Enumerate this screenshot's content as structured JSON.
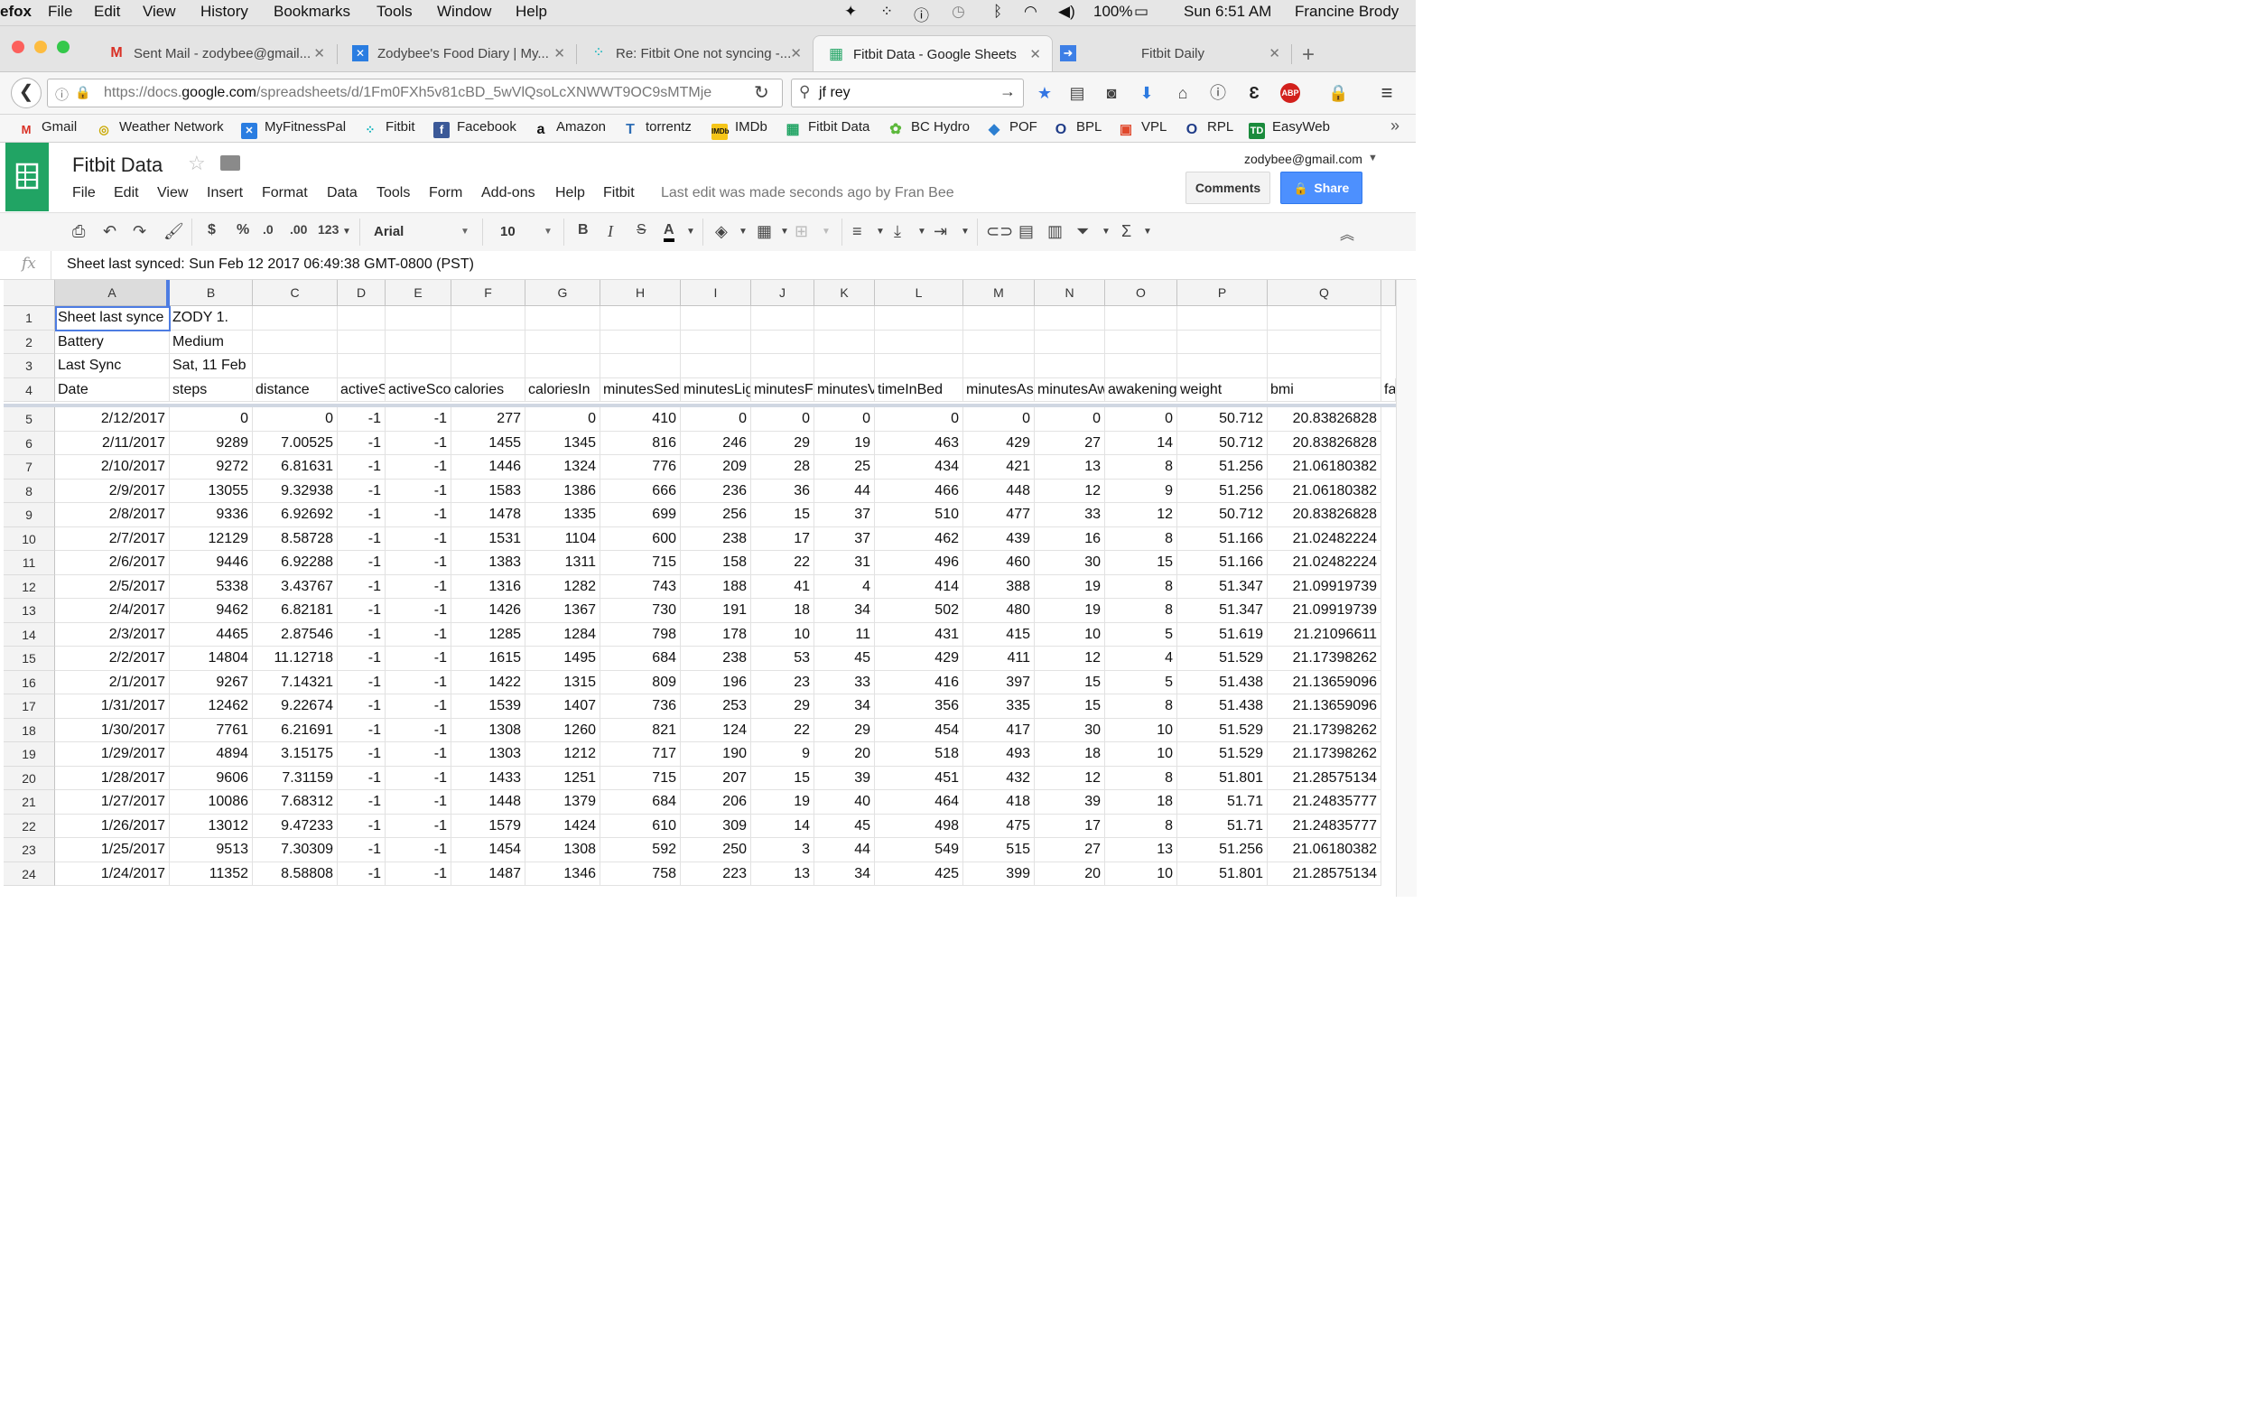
{
  "menubar": {
    "app": "efox",
    "items": [
      "File",
      "Edit",
      "View",
      "History",
      "Bookmarks",
      "Tools",
      "Window",
      "Help"
    ],
    "battery": "100%",
    "clock": "Sun 6:51 AM",
    "user": "Francine Brody"
  },
  "tabs": [
    {
      "title": "Sent Mail - zodybee@gmail...",
      "icon": "gmail-icon"
    },
    {
      "title": "Zodybee's Food Diary | My...",
      "icon": "myfitnesspal-icon"
    },
    {
      "title": "Re: Fitbit One not syncing -...",
      "icon": "fitbit-icon"
    },
    {
      "title": "Fitbit Data - Google Sheets",
      "icon": "sheets-icon"
    },
    {
      "title": "Fitbit Daily",
      "icon": "arrow-icon"
    }
  ],
  "navbar": {
    "url_host_prefix": "https://docs.",
    "url_host": "google.com",
    "url_path": "/spreadsheets/d/1Fm0FXh5v81cBD_5wVlQsoLcXNWWT9OC9sMTMje",
    "search_value": "jf rey"
  },
  "bookmarks": [
    {
      "label": "Gmail",
      "icon": "gmail-icon"
    },
    {
      "label": "Weather Network",
      "icon": "weather-icon"
    },
    {
      "label": "MyFitnessPal",
      "icon": "myfitnesspal-icon"
    },
    {
      "label": "Fitbit",
      "icon": "fitbit-icon"
    },
    {
      "label": "Facebook",
      "icon": "facebook-icon"
    },
    {
      "label": "Amazon",
      "icon": "amazon-icon"
    },
    {
      "label": "torrentz",
      "icon": "torrentz-icon"
    },
    {
      "label": "IMDb",
      "icon": "imdb-icon"
    },
    {
      "label": "Fitbit Data",
      "icon": "sheets-icon"
    },
    {
      "label": "BC Hydro",
      "icon": "bchydro-icon"
    },
    {
      "label": "POF",
      "icon": "pof-icon"
    },
    {
      "label": "BPL",
      "icon": "bpl-icon"
    },
    {
      "label": "VPL",
      "icon": "vpl-icon"
    },
    {
      "label": "RPL",
      "icon": "rpl-icon"
    },
    {
      "label": "EasyWeb",
      "icon": "td-icon"
    }
  ],
  "sheets": {
    "title": "Fitbit Data",
    "menus": [
      "File",
      "Edit",
      "View",
      "Insert",
      "Format",
      "Data",
      "Tools",
      "Form",
      "Add-ons",
      "Help",
      "Fitbit"
    ],
    "last_edit": "Last edit was made seconds ago by Fran Bee",
    "account": "zodybee@gmail.com",
    "comments_label": "Comments",
    "share_label": "Share"
  },
  "toolbar": {
    "currency": "$",
    "percent": "%",
    "dec_less": ".0",
    "dec_more": ".00",
    "format_more": "123",
    "font": "Arial",
    "size": "10",
    "bold": "B",
    "italic": "I",
    "strike": "S",
    "textcolor": "A"
  },
  "formula": {
    "fx": "fx",
    "value": "Sheet last synced: Sun Feb 12 2017 06:49:38 GMT-0800 (PST)"
  },
  "colors": {
    "sheets_green": "#21a464",
    "share_blue": "#4d90fe",
    "selection": "#4d7ce2"
  },
  "grid": {
    "columns": [
      "A",
      "B",
      "C",
      "D",
      "E",
      "F",
      "G",
      "H",
      "I",
      "J",
      "K",
      "L",
      "M",
      "N",
      "O",
      "P",
      "Q"
    ],
    "rows": [
      {
        "n": "1",
        "cells": [
          "Sheet last synce",
          "ZODY 1."
        ]
      },
      {
        "n": "2",
        "cells": [
          "Battery",
          "Medium"
        ]
      },
      {
        "n": "3",
        "cells": [
          "Last Sync",
          "Sat, 11 Feb"
        ]
      },
      {
        "n": "4",
        "cells": [
          "Date",
          "steps",
          "distance",
          "activeS",
          "activeSco",
          "calories",
          "caloriesIn",
          "minutesSed",
          "minutesLig",
          "minutesF",
          "minutesV",
          "timeInBed",
          "minutesAs",
          "minutesAw",
          "awakening",
          "weight",
          "bmi",
          "fa"
        ]
      },
      {
        "n": "5",
        "cells": [
          "2/12/2017",
          "0",
          "0",
          "-1",
          "-1",
          "277",
          "0",
          "410",
          "0",
          "0",
          "0",
          "0",
          "0",
          "0",
          "0",
          "50.712",
          "20.83826828"
        ]
      },
      {
        "n": "6",
        "cells": [
          "2/11/2017",
          "9289",
          "7.00525",
          "-1",
          "-1",
          "1455",
          "1345",
          "816",
          "246",
          "29",
          "19",
          "463",
          "429",
          "27",
          "14",
          "50.712",
          "20.83826828"
        ]
      },
      {
        "n": "7",
        "cells": [
          "2/10/2017",
          "9272",
          "6.81631",
          "-1",
          "-1",
          "1446",
          "1324",
          "776",
          "209",
          "28",
          "25",
          "434",
          "421",
          "13",
          "8",
          "51.256",
          "21.06180382"
        ]
      },
      {
        "n": "8",
        "cells": [
          "2/9/2017",
          "13055",
          "9.32938",
          "-1",
          "-1",
          "1583",
          "1386",
          "666",
          "236",
          "36",
          "44",
          "466",
          "448",
          "12",
          "9",
          "51.256",
          "21.06180382"
        ]
      },
      {
        "n": "9",
        "cells": [
          "2/8/2017",
          "9336",
          "6.92692",
          "-1",
          "-1",
          "1478",
          "1335",
          "699",
          "256",
          "15",
          "37",
          "510",
          "477",
          "33",
          "12",
          "50.712",
          "20.83826828"
        ]
      },
      {
        "n": "10",
        "cells": [
          "2/7/2017",
          "12129",
          "8.58728",
          "-1",
          "-1",
          "1531",
          "1104",
          "600",
          "238",
          "17",
          "37",
          "462",
          "439",
          "16",
          "8",
          "51.166",
          "21.02482224"
        ]
      },
      {
        "n": "11",
        "cells": [
          "2/6/2017",
          "9446",
          "6.92288",
          "-1",
          "-1",
          "1383",
          "1311",
          "715",
          "158",
          "22",
          "31",
          "496",
          "460",
          "30",
          "15",
          "51.166",
          "21.02482224"
        ]
      },
      {
        "n": "12",
        "cells": [
          "2/5/2017",
          "5338",
          "3.43767",
          "-1",
          "-1",
          "1316",
          "1282",
          "743",
          "188",
          "41",
          "4",
          "414",
          "388",
          "19",
          "8",
          "51.347",
          "21.09919739"
        ]
      },
      {
        "n": "13",
        "cells": [
          "2/4/2017",
          "9462",
          "6.82181",
          "-1",
          "-1",
          "1426",
          "1367",
          "730",
          "191",
          "18",
          "34",
          "502",
          "480",
          "19",
          "8",
          "51.347",
          "21.09919739"
        ]
      },
      {
        "n": "14",
        "cells": [
          "2/3/2017",
          "4465",
          "2.87546",
          "-1",
          "-1",
          "1285",
          "1284",
          "798",
          "178",
          "10",
          "11",
          "431",
          "415",
          "10",
          "5",
          "51.619",
          "21.21096611"
        ]
      },
      {
        "n": "15",
        "cells": [
          "2/2/2017",
          "14804",
          "11.12718",
          "-1",
          "-1",
          "1615",
          "1495",
          "684",
          "238",
          "53",
          "45",
          "429",
          "411",
          "12",
          "4",
          "51.529",
          "21.17398262"
        ]
      },
      {
        "n": "16",
        "cells": [
          "2/1/2017",
          "9267",
          "7.14321",
          "-1",
          "-1",
          "1422",
          "1315",
          "809",
          "196",
          "23",
          "33",
          "416",
          "397",
          "15",
          "5",
          "51.438",
          "21.13659096"
        ]
      },
      {
        "n": "17",
        "cells": [
          "1/31/2017",
          "12462",
          "9.22674",
          "-1",
          "-1",
          "1539",
          "1407",
          "736",
          "253",
          "29",
          "34",
          "356",
          "335",
          "15",
          "8",
          "51.438",
          "21.13659096"
        ]
      },
      {
        "n": "18",
        "cells": [
          "1/30/2017",
          "7761",
          "6.21691",
          "-1",
          "-1",
          "1308",
          "1260",
          "821",
          "124",
          "22",
          "29",
          "454",
          "417",
          "30",
          "10",
          "51.529",
          "21.17398262"
        ]
      },
      {
        "n": "19",
        "cells": [
          "1/29/2017",
          "4894",
          "3.15175",
          "-1",
          "-1",
          "1303",
          "1212",
          "717",
          "190",
          "9",
          "20",
          "518",
          "493",
          "18",
          "10",
          "51.529",
          "21.17398262"
        ]
      },
      {
        "n": "20",
        "cells": [
          "1/28/2017",
          "9606",
          "7.31159",
          "-1",
          "-1",
          "1433",
          "1251",
          "715",
          "207",
          "15",
          "39",
          "451",
          "432",
          "12",
          "8",
          "51.801",
          "21.28575134"
        ]
      },
      {
        "n": "21",
        "cells": [
          "1/27/2017",
          "10086",
          "7.68312",
          "-1",
          "-1",
          "1448",
          "1379",
          "684",
          "206",
          "19",
          "40",
          "464",
          "418",
          "39",
          "18",
          "51.71",
          "21.24835777"
        ]
      },
      {
        "n": "22",
        "cells": [
          "1/26/2017",
          "13012",
          "9.47233",
          "-1",
          "-1",
          "1579",
          "1424",
          "610",
          "309",
          "14",
          "45",
          "498",
          "475",
          "17",
          "8",
          "51.71",
          "21.24835777"
        ]
      },
      {
        "n": "23",
        "cells": [
          "1/25/2017",
          "9513",
          "7.30309",
          "-1",
          "-1",
          "1454",
          "1308",
          "592",
          "250",
          "3",
          "44",
          "549",
          "515",
          "27",
          "13",
          "51.256",
          "21.06180382"
        ]
      },
      {
        "n": "24",
        "cells": [
          "1/24/2017",
          "11352",
          "8.58808",
          "-1",
          "-1",
          "1487",
          "1346",
          "758",
          "223",
          "13",
          "34",
          "425",
          "399",
          "20",
          "10",
          "51.801",
          "21.28575134"
        ]
      }
    ]
  }
}
